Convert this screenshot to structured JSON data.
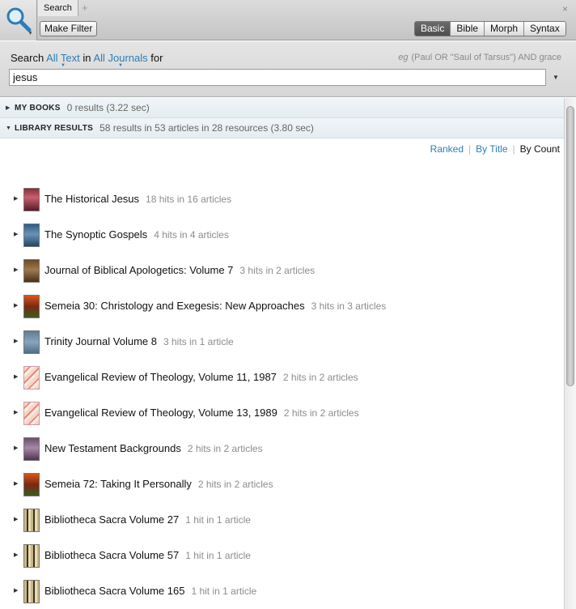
{
  "toolbar": {
    "tab_label": "Search",
    "add_tab": "+",
    "close_tab": "×",
    "make_filter": "Make Filter",
    "modes": [
      "Basic",
      "Bible",
      "Morph",
      "Syntax"
    ],
    "active_mode": "Basic"
  },
  "query": {
    "prefix": "Search",
    "scope": "All Text",
    "in": "in",
    "collection": "All Journals",
    "for": "for",
    "example_label": "eg",
    "example": "(Paul OR \"Saul of Tarsus\") AND grace",
    "value": "jesus"
  },
  "sections": {
    "my_books": {
      "title": "MY BOOKS",
      "summary": "0 results (3.22 sec)"
    },
    "library": {
      "title": "LIBRARY RESULTS",
      "summary": "58 results in 53 articles in 28 resources (3.80 sec)"
    }
  },
  "sort": {
    "ranked": "Ranked",
    "by_title": "By Title",
    "by_count": "By Count",
    "current": "By Count"
  },
  "results": [
    {
      "title": "The Historical Jesus",
      "hits": "18 hits in 16 articles",
      "cover": "red"
    },
    {
      "title": "The Synoptic Gospels",
      "hits": "4 hits in 4 articles",
      "cover": "blue"
    },
    {
      "title": "Journal of Biblical Apologetics: Volume 7",
      "hits": "3 hits in 2 articles",
      "cover": "brown"
    },
    {
      "title": "Semeia 30: Christology and Exegesis: New Approaches",
      "hits": "3 hits in 3 articles",
      "cover": "orange"
    },
    {
      "title": "Trinity Journal Volume 8",
      "hits": "3 hits in 1 article",
      "cover": "slate"
    },
    {
      "title": "Evangelical Review of Theology, Volume 11, 1987",
      "hits": "2 hits in 2 articles",
      "cover": "pinkstripe"
    },
    {
      "title": "Evangelical Review of Theology, Volume 13, 1989",
      "hits": "2 hits in 2 articles",
      "cover": "pinkstripe"
    },
    {
      "title": "New Testament Backgrounds",
      "hits": "2 hits in 2 articles",
      "cover": "mauve"
    },
    {
      "title": "Semeia 72: Taking It Personally",
      "hits": "2 hits in 2 articles",
      "cover": "orange"
    },
    {
      "title": "Bibliotheca Sacra Volume 27",
      "hits": "1 hit in 1 article",
      "cover": "tan"
    },
    {
      "title": "Bibliotheca Sacra Volume 57",
      "hits": "1 hit in 1 article",
      "cover": "tan"
    },
    {
      "title": "Bibliotheca Sacra Volume 165",
      "hits": "1 hit in 1 article",
      "cover": "tan"
    }
  ]
}
